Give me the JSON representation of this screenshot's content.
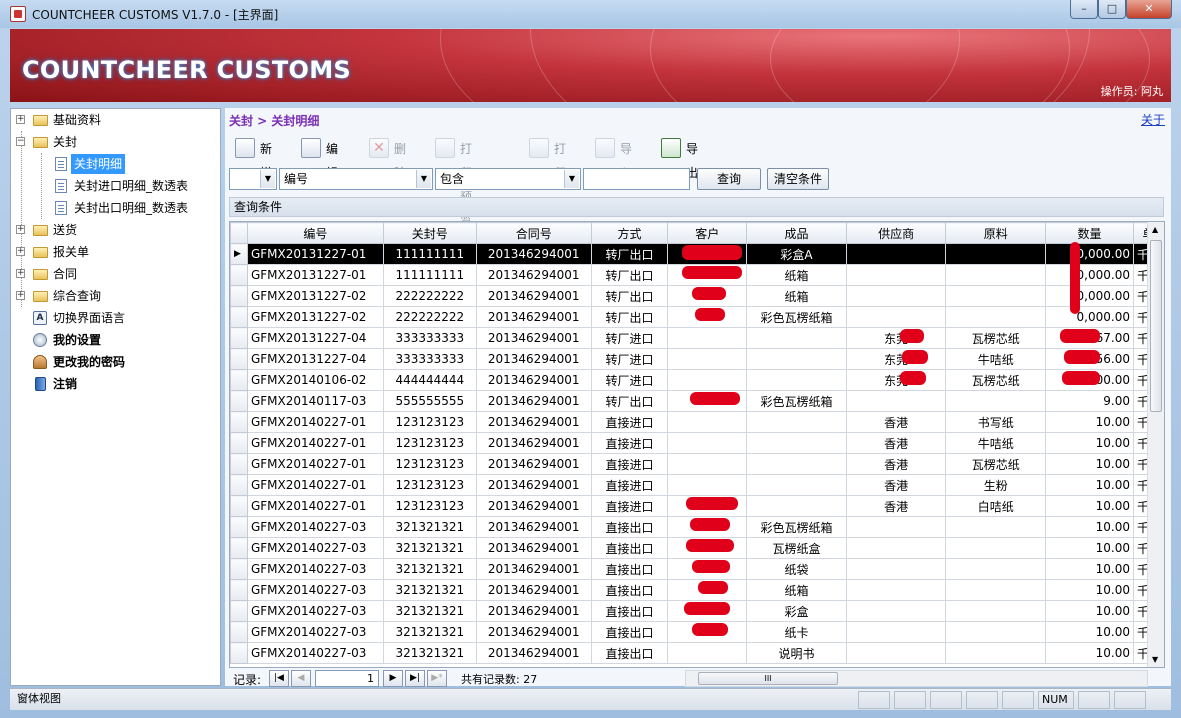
{
  "window": {
    "title": "COUNTCHEER CUSTOMS V1.7.0 - [主界面]",
    "minimize": "–",
    "maximize": "□",
    "close": "✕"
  },
  "banner": {
    "brand": "COUNTCHEER CUSTOMS",
    "operator": "操作员: 阿丸"
  },
  "sidebar": {
    "items": [
      {
        "label": "基础资料",
        "expand": "+"
      },
      {
        "label": "关封",
        "expand": "−"
      },
      {
        "label": "关封明细"
      },
      {
        "label": "关封进口明细_数透表"
      },
      {
        "label": "关封出口明细_数透表"
      },
      {
        "label": "送货",
        "expand": "+"
      },
      {
        "label": "报关单",
        "expand": "+"
      },
      {
        "label": "合同",
        "expand": "+"
      },
      {
        "label": "综合查询",
        "expand": "+"
      },
      {
        "label": "切换界面语言"
      },
      {
        "label": "我的设置"
      },
      {
        "label": "更改我的密码"
      },
      {
        "label": "注销"
      }
    ]
  },
  "content": {
    "breadcrumb": "关封 > 关封明细",
    "close_link": "关于"
  },
  "toolbar": {
    "new": "新增",
    "edit": "编辑",
    "delete": "删除",
    "print_preview": "打印预览",
    "print": "打印",
    "import": "导入",
    "export": "导出"
  },
  "filter": {
    "field": "编号",
    "operator": "包含",
    "value": "",
    "query": "查询",
    "clear": "清空条件",
    "conditions_label": "查询条件"
  },
  "table": {
    "columns": [
      "编号",
      "关封号",
      "合同号",
      "方式",
      "客户",
      "成品",
      "供应商",
      "原料",
      "数量",
      "单"
    ],
    "rows": [
      [
        "GFMX20131227-01",
        "111111111",
        "201346294001",
        "转厂出口",
        "",
        "彩盒A",
        "",
        "",
        "0,000.00",
        "千"
      ],
      [
        "GFMX20131227-01",
        "111111111",
        "201346294001",
        "转厂出口",
        "",
        "纸箱",
        "",
        "",
        "0,000.00",
        "千"
      ],
      [
        "GFMX20131227-02",
        "222222222",
        "201346294001",
        "转厂出口",
        "",
        "纸箱",
        "",
        "",
        "0,000.00",
        "千"
      ],
      [
        "GFMX20131227-02",
        "222222222",
        "201346294001",
        "转厂出口",
        "",
        "彩色瓦楞纸箱",
        "",
        "",
        "0,000.00",
        "千"
      ],
      [
        "GFMX20131227-04",
        "333333333",
        "201346294001",
        "转厂进口",
        "",
        "",
        "东莞",
        "瓦楞芯纸",
        "567.00",
        "千"
      ],
      [
        "GFMX20131227-04",
        "333333333",
        "201346294001",
        "转厂进口",
        "",
        "",
        "东莞",
        "牛咭纸",
        "56.00",
        "千"
      ],
      [
        "GFMX20140106-02",
        "444444444",
        "201346294001",
        "转厂进口",
        "",
        "",
        "东莞",
        "瓦楞芯纸",
        "000.00",
        "千"
      ],
      [
        "GFMX20140117-03",
        "555555555",
        "201346294001",
        "转厂出口",
        "",
        "彩色瓦楞纸箱",
        "",
        "",
        "9.00",
        "千"
      ],
      [
        "GFMX20140227-01",
        "123123123",
        "201346294001",
        "直接进口",
        "",
        "",
        "香港",
        "书写纸",
        "10.00",
        "千"
      ],
      [
        "GFMX20140227-01",
        "123123123",
        "201346294001",
        "直接进口",
        "",
        "",
        "香港",
        "牛咭纸",
        "10.00",
        "千"
      ],
      [
        "GFMX20140227-01",
        "123123123",
        "201346294001",
        "直接进口",
        "",
        "",
        "香港",
        "瓦楞芯纸",
        "10.00",
        "千"
      ],
      [
        "GFMX20140227-01",
        "123123123",
        "201346294001",
        "直接进口",
        "",
        "",
        "香港",
        "生粉",
        "10.00",
        "千"
      ],
      [
        "GFMX20140227-01",
        "123123123",
        "201346294001",
        "直接进口",
        "",
        "",
        "香港",
        "白咭纸",
        "10.00",
        "千"
      ],
      [
        "GFMX20140227-03",
        "321321321",
        "201346294001",
        "直接出口",
        "",
        "彩色瓦楞纸箱",
        "",
        "",
        "10.00",
        "千"
      ],
      [
        "GFMX20140227-03",
        "321321321",
        "201346294001",
        "直接出口",
        "",
        "瓦楞纸盒",
        "",
        "",
        "10.00",
        "千"
      ],
      [
        "GFMX20140227-03",
        "321321321",
        "201346294001",
        "直接出口",
        "",
        "纸袋",
        "",
        "",
        "10.00",
        "千"
      ],
      [
        "GFMX20140227-03",
        "321321321",
        "201346294001",
        "直接出口",
        "",
        "纸箱",
        "",
        "",
        "10.00",
        "千"
      ],
      [
        "GFMX20140227-03",
        "321321321",
        "201346294001",
        "直接出口",
        "",
        "彩盒",
        "",
        "",
        "10.00",
        "千"
      ],
      [
        "GFMX20140227-03",
        "321321321",
        "201346294001",
        "直接出口",
        "",
        "纸卡",
        "",
        "",
        "10.00",
        "千"
      ],
      [
        "GFMX20140227-03",
        "321321321",
        "201346294001",
        "直接出口",
        "",
        "说明书",
        "",
        "",
        "10.00",
        "千"
      ]
    ]
  },
  "navigator": {
    "label": "记录:",
    "current": "1",
    "total": "共有记录数: 27"
  },
  "status": {
    "view": "窗体视图",
    "num": "NUM"
  }
}
